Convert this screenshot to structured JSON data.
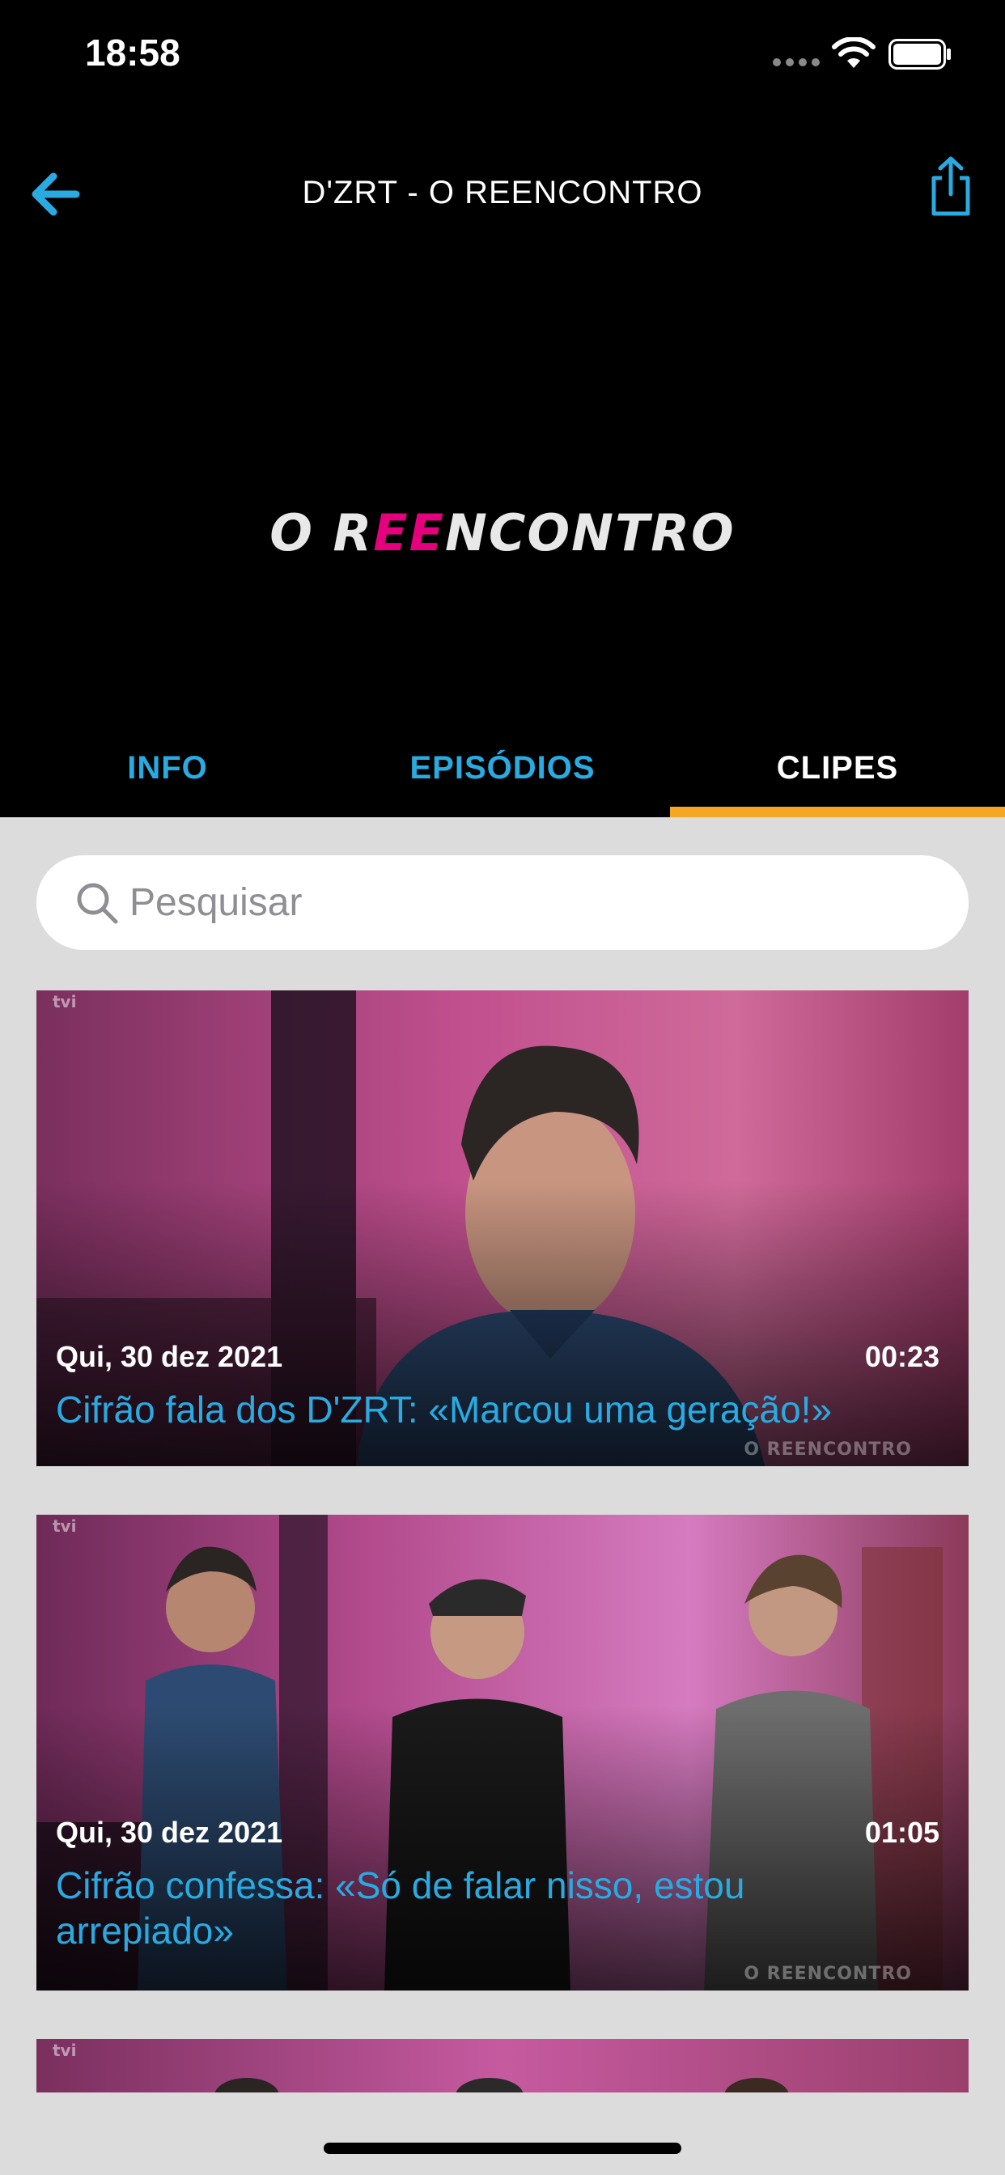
{
  "status_bar": {
    "time": "18:58"
  },
  "nav": {
    "title": "D'ZRT - O REENCONTRO"
  },
  "hero": {
    "logo_text_a": "O R",
    "logo_text_accent": "EE",
    "logo_text_b": "NCONTRO"
  },
  "tabs": [
    {
      "label": "INFO",
      "active": false
    },
    {
      "label": "EPISÓDIOS",
      "active": false
    },
    {
      "label": "CLIPES",
      "active": true
    }
  ],
  "search": {
    "placeholder": "Pesquisar"
  },
  "clips": [
    {
      "date": "Qui, 30 dez 2021",
      "duration": "00:23",
      "title": "Cifrão fala dos D'ZRT: «Marcou uma geração!»",
      "watermark": "O REENCONTRO",
      "channel_mark": "tvi"
    },
    {
      "date": "Qui, 30 dez 2021",
      "duration": "01:05",
      "title": "Cifrão confessa: «Só de falar nisso, estou arrepiado»",
      "watermark": "O REENCONTRO",
      "channel_mark": "tvi"
    },
    {
      "channel_mark": "tvi"
    }
  ],
  "colors": {
    "accent_blue": "#29abe2",
    "tab_indicator": "#f5a623",
    "logo_pink": "#e6007e",
    "background": "#dcdcdc",
    "header_bg": "#000000"
  },
  "icons": {
    "back": "arrow-left-icon",
    "share": "share-icon",
    "search": "search-icon",
    "wifi": "wifi-icon",
    "battery": "battery-icon"
  }
}
